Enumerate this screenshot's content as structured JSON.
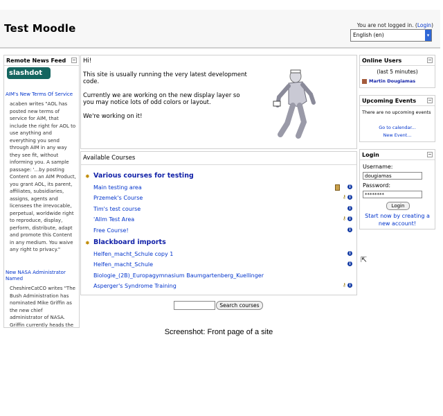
{
  "header": {
    "site_title": "Test Moodle",
    "login_text": "You are not logged in. (",
    "login_link": "Login",
    "login_close": ")",
    "language": "English (en)"
  },
  "news": {
    "title": "Remote News Feed",
    "logo_text": "slashdot",
    "item1_title": "AIM's New Terms Of Service",
    "item1_body": "acaben writes \"AOL has posted new terms of service for AIM, that include the right for AOL to use anything and everything you send through AIM in any way they see fit, without informing you. A sample passage: '...by posting Content on an AIM Product, you grant AOL, its parent, affiliates, subsidiaries, assigns, agents and licensees the irrevocable, perpetual, worldwide right to reproduce, display, perform, distribute, adapt and promote this Content in any medium. You waive any right to privacy.\"",
    "item2_title": "New NASA Administrator Named",
    "item2_body": "CheshireCatCO writes \"The Bush Administration has nominated Mike Griffin as the new chief administrator of NASA. Griffin currently heads the"
  },
  "intro": {
    "greeting": "Hi!",
    "line1": "This site is usually running the very latest development code.",
    "line2": "Currently we are working on the new display layer so you may notice lots of odd colors or layout.",
    "line3": "We're working on it!"
  },
  "courses": {
    "title": "Available Courses",
    "cat1": "Various courses for testing",
    "cat1_items": [
      "Main testing area",
      "Przemek's Course",
      "Tim's test course",
      "'Allm Test Area",
      "Free Course!"
    ],
    "cat2": "Blackboard imports",
    "cat2_items": [
      "Helfen_macht_Schule copy 1",
      "Helfen_macht_Schule",
      "Biologie_(2B)_Europagymnasium Baumgartenberg_Kuellinger",
      "Asperger's Syndrome Training"
    ]
  },
  "search": {
    "button": "Search courses"
  },
  "online": {
    "title": "Online Users",
    "sub": "(last 5 minutes)",
    "user": "Martin Dougiamas"
  },
  "upcoming": {
    "title": "Upcoming Events",
    "none": "There are no upcoming events",
    "goto": "Go to calendar...",
    "new_event": "New Event..."
  },
  "login": {
    "title": "Login",
    "username_label": "Username:",
    "username_value": "dougiamas",
    "password_label": "Password:",
    "password_value": "********",
    "button": "Login",
    "start": "Start now by creating a new account!"
  },
  "caption": "Screenshot: Front page of a site"
}
